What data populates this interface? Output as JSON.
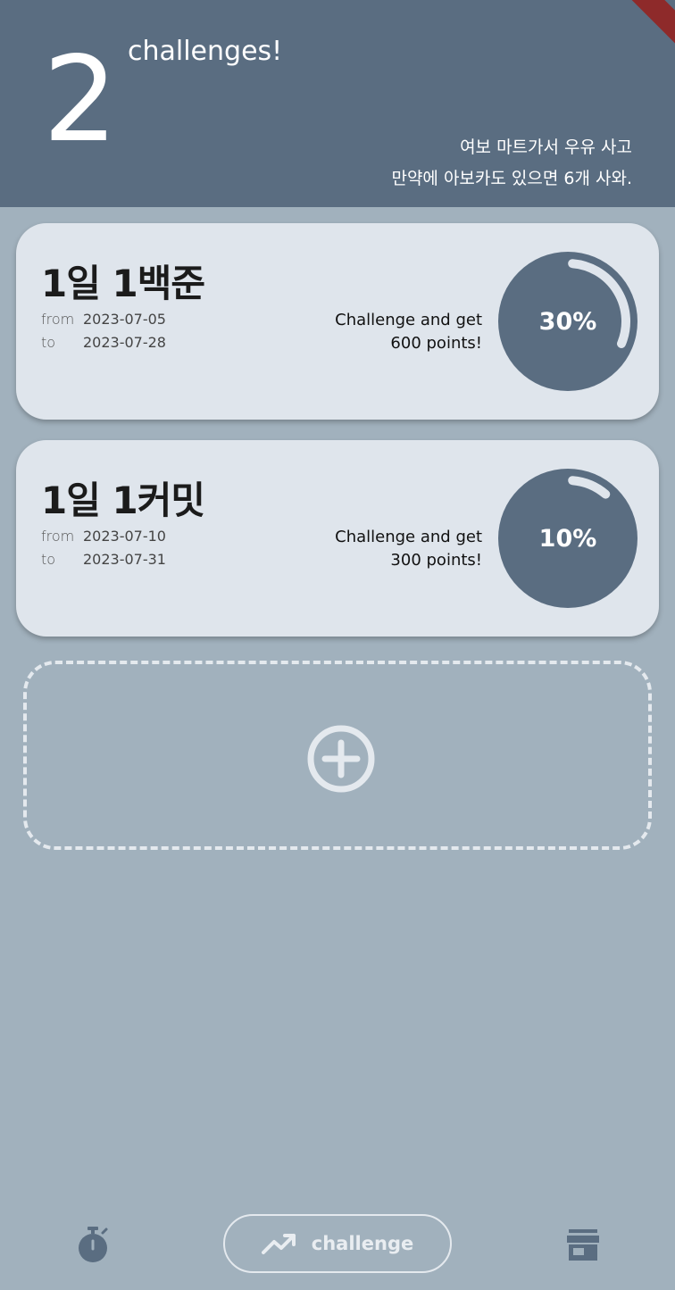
{
  "header": {
    "challenge_count": "2",
    "count_label": "challenges!",
    "memo_line1": "여보 마트가서 우유 사고",
    "memo_line2": "만약에 아보카도 있으면 6개 사와."
  },
  "challenges": [
    {
      "title": "1일 1백준",
      "from_label": "from",
      "from_date": "2023-07-05",
      "to_label": "to",
      "to_date": "2023-07-28",
      "reward_line1": "Challenge and get",
      "reward_line2": "600 points!",
      "progress_text": "30%",
      "progress": 0.3
    },
    {
      "title": "1일 1커밋",
      "from_label": "from",
      "from_date": "2023-07-10",
      "to_label": "to",
      "to_date": "2023-07-31",
      "reward_line1": "Challenge and get",
      "reward_line2": "300 points!",
      "progress_text": "10%",
      "progress": 0.1
    }
  ],
  "add_button": {
    "icon": "plus-circle-icon"
  },
  "bottom_nav": {
    "left_icon": "timer-icon",
    "center_icon": "trending-up-icon",
    "center_label": "challenge",
    "right_icon": "store-icon"
  },
  "colors": {
    "header_bg": "#5a6d81",
    "page_bg": "#a1b1bd",
    "card_bg": "#dfe5ec",
    "progress_fill": "#5a6d81",
    "accent_light": "#e4e9ee"
  }
}
